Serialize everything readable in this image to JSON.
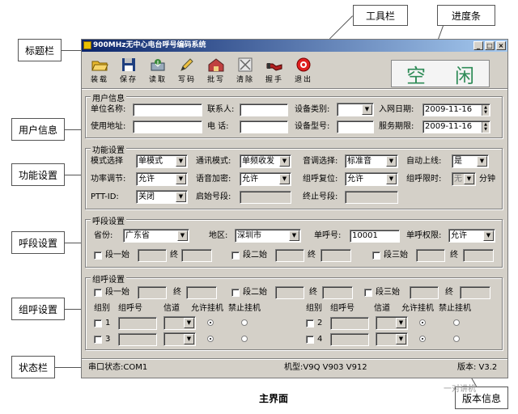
{
  "callouts": {
    "title_bar": "标题栏",
    "toolbar": "工具栏",
    "progress": "进度条",
    "user_info": "用户信息",
    "func_settings": "功能设置",
    "call_settings": "呼段设置",
    "group_settings": "组呼设置",
    "status_bar": "状态栏",
    "version_info": "版本信息"
  },
  "window": {
    "title": "900MHz无中心电台呼号编码系统",
    "min": "_",
    "max": "□",
    "close": "×"
  },
  "toolbar": {
    "items": [
      {
        "label": "装载",
        "icon": "folder-open-icon"
      },
      {
        "label": "保存",
        "icon": "floppy-disk-icon"
      },
      {
        "label": "读取",
        "icon": "read-icon"
      },
      {
        "label": "写码",
        "icon": "pencil-icon"
      },
      {
        "label": "批写",
        "icon": "batch-write-icon"
      },
      {
        "label": "清除",
        "icon": "clear-icon"
      },
      {
        "label": "握手",
        "icon": "handshake-icon"
      },
      {
        "label": "退出",
        "icon": "exit-icon"
      }
    ],
    "status_char1": "空",
    "status_char2": "闲"
  },
  "user_info": {
    "title": "用户信息",
    "unit_name_label": "单位名称:",
    "unit_name": "",
    "contact_label": "联系人:",
    "contact": "",
    "device_cat_label": "设备类别:",
    "device_cat": "",
    "join_date_label": "入网日期:",
    "join_date": "2009-11-16",
    "address_label": "使用地址:",
    "address": "",
    "phone_label": "电  话:",
    "phone": "",
    "device_model_label": "设备型号:",
    "device_model": "",
    "service_period_label": "服务期限:",
    "service_period": "2009-11-16"
  },
  "func": {
    "title": "功能设置",
    "mode_label": "模式选择",
    "mode": "单模式",
    "comm_mode_label": "通讯模式:",
    "comm_mode": "单频收发",
    "tone_label": "音调选择:",
    "tone": "标准音",
    "auto_online_label": "自动上线:",
    "auto_online": "是",
    "power_label": "功率调节:",
    "power": "允许",
    "voice_enc_label": "语音加密:",
    "voice_enc": "允许",
    "group_reset_label": "组呼复位:",
    "group_reset": "允许",
    "group_limit_label": "组呼限时:",
    "group_limit": "无",
    "minute_label": "分钟",
    "ptt_label": "PTT-ID:",
    "ptt": "关闭",
    "start_no_label": "启始号段:",
    "start_no": "",
    "end_no_label": "终止号段:",
    "end_no": ""
  },
  "call": {
    "title": "呼段设置",
    "province_label": "省份:",
    "province": "广东省",
    "region_label": "地区:",
    "region": "深圳市",
    "single_no_label": "单呼号:",
    "single_no": "10001",
    "single_perm_label": "单呼权限:",
    "single_perm": "允许",
    "seg1_label": "段一始",
    "seg2_label": "段二始",
    "seg3_label": "段三始",
    "end_label": "终"
  },
  "group": {
    "title": "组呼设置",
    "seg1_label": "段一始",
    "seg2_label": "段二始",
    "seg3_label": "段三始",
    "end_label": "终",
    "col_group": "组别",
    "col_no": "组呼号",
    "col_channel": "信道",
    "col_allow": "允许挂机",
    "col_forbid": "禁止挂机",
    "rows_left": [
      "1",
      "3"
    ],
    "rows_right": [
      "2",
      "4"
    ]
  },
  "status": {
    "port": "串口状态:COM1",
    "model": "机型:V9Q V903 V912",
    "version": "版本: V3.2"
  },
  "caption": "主界面",
  "watermark": "一对讲机"
}
